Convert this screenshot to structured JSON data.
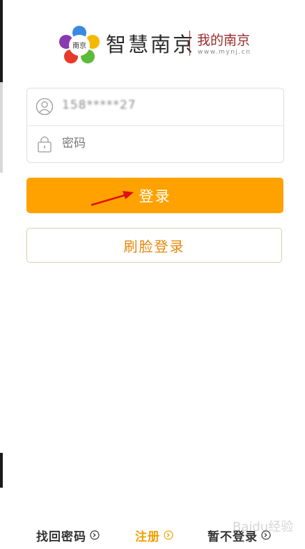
{
  "header": {
    "logo_text": "南京",
    "brand_name": "智慧南京",
    "brand_sub": "我的南京",
    "brand_url": "www.mynj.cn"
  },
  "form": {
    "account_value": "158*****27",
    "password_placeholder": "密码",
    "user_icon": "user-icon",
    "lock_icon": "lock-icon"
  },
  "buttons": {
    "login_label": "登录",
    "face_login_label": "刷脸登录"
  },
  "footer": {
    "forgot_password": "找回密码",
    "register": "注册",
    "skip_login": "暂不登录"
  },
  "colors": {
    "primary": "#ffa200",
    "face_text": "#e8870a",
    "brand_red": "#9b2a2a",
    "annotation_arrow": "#e01010"
  },
  "watermark": "Baidu经验"
}
